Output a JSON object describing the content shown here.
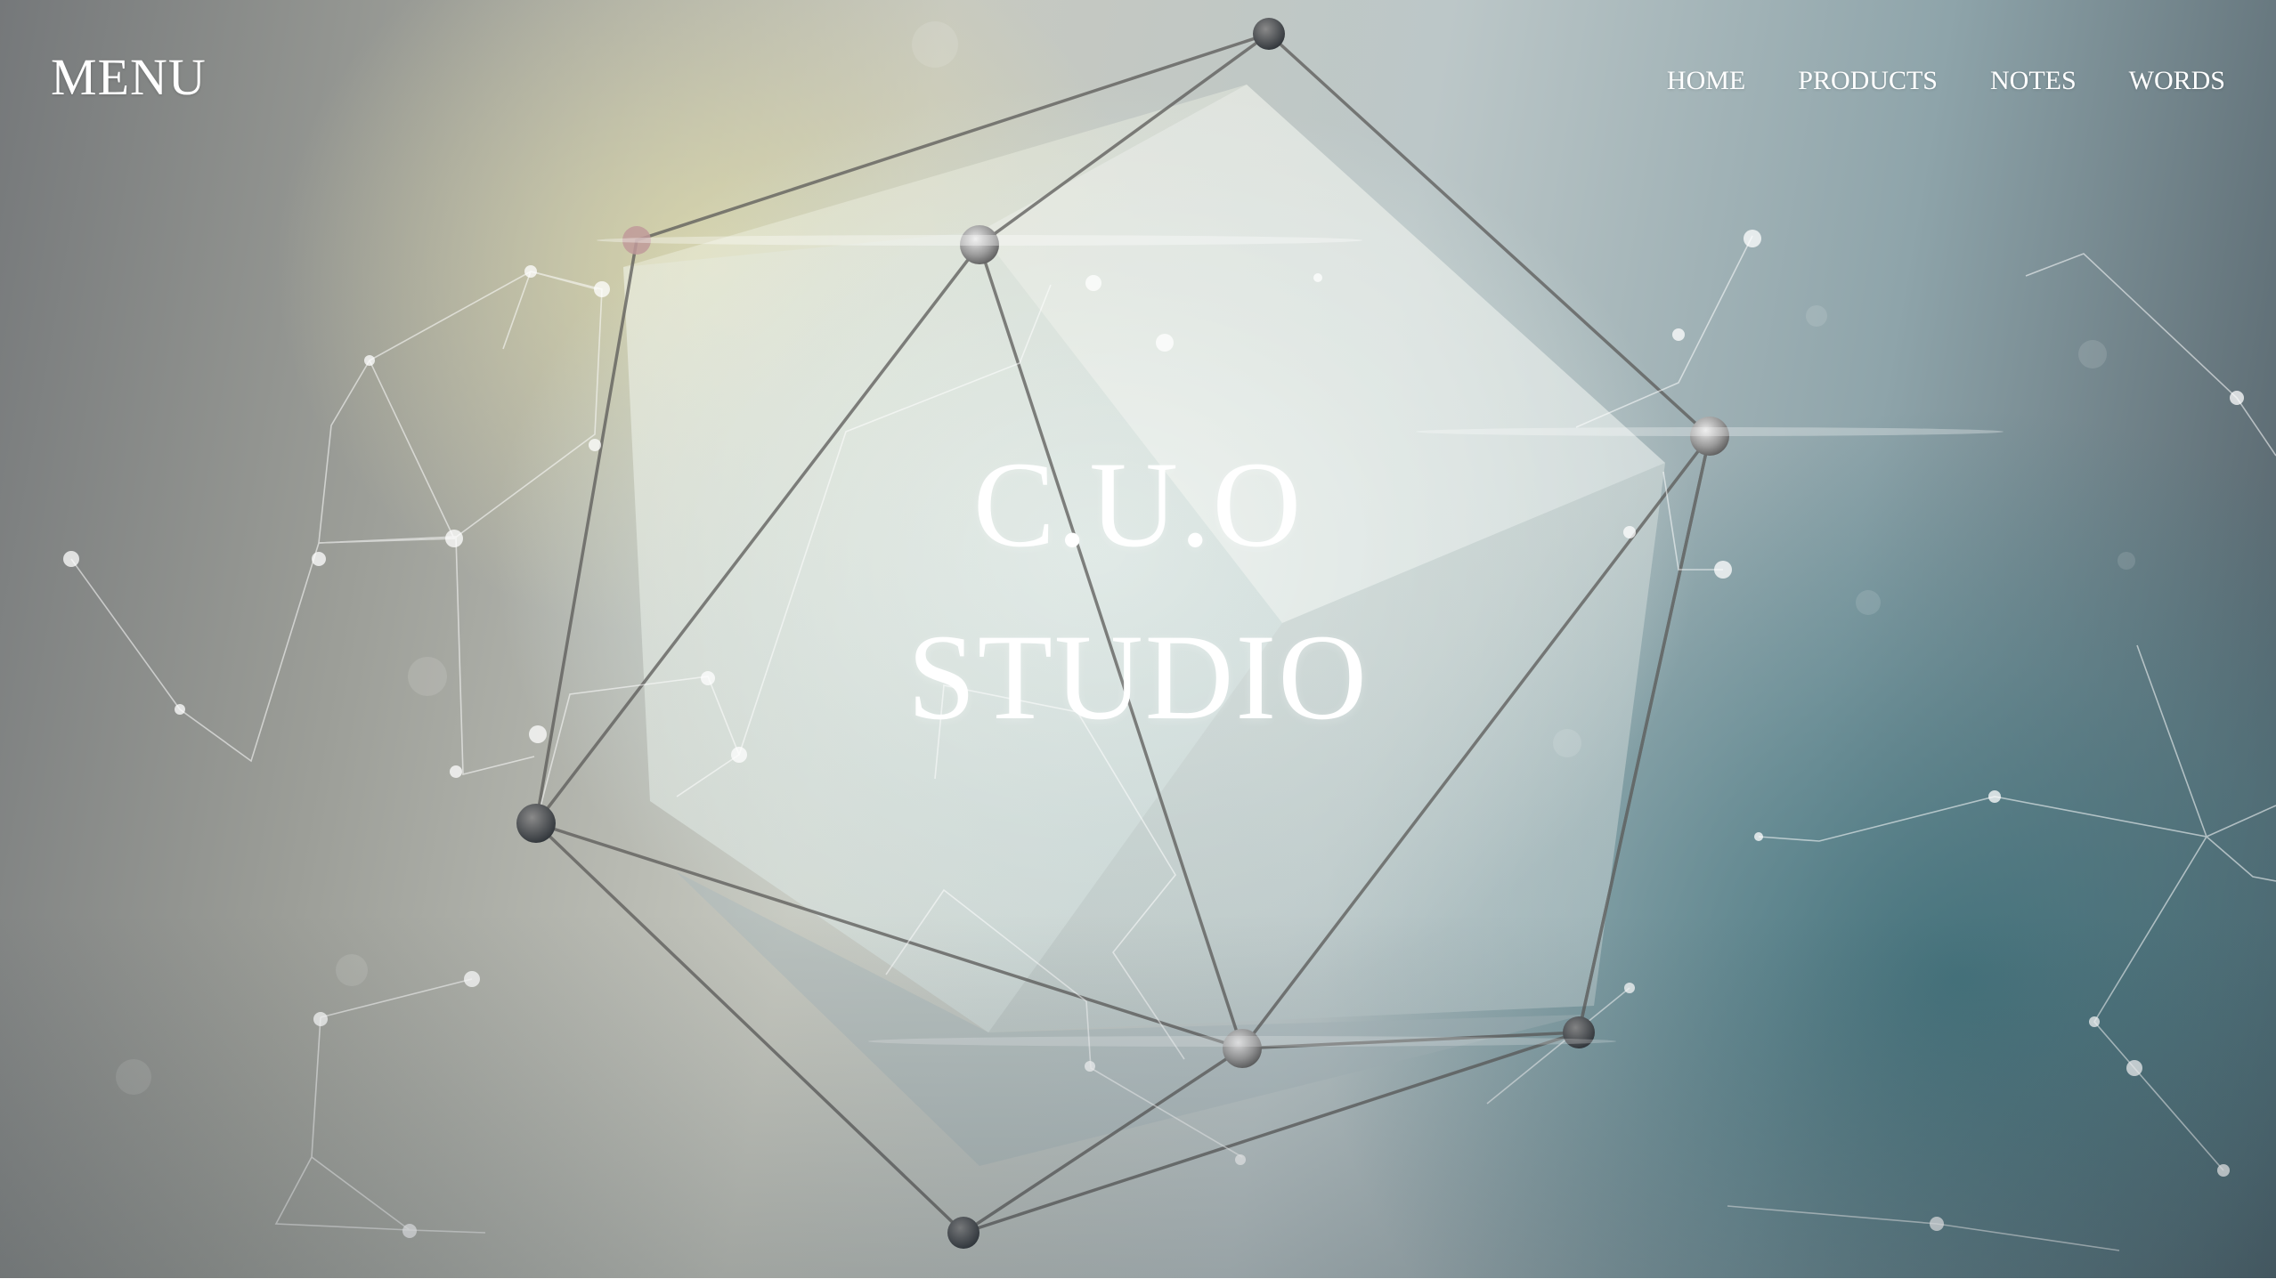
{
  "header": {
    "menu_label": "MENU",
    "nav": [
      {
        "label": "HOME"
      },
      {
        "label": "PRODUCTS"
      },
      {
        "label": "NOTES"
      },
      {
        "label": "WORDS"
      }
    ]
  },
  "hero": {
    "title_line1": "C.U.O",
    "title_line2": "STUDIO"
  },
  "background": {
    "image": "abstract-polyhedron-network",
    "colors": {
      "left": "#75787a",
      "center": "#e6ece8",
      "warm_highlight": "#e2dcaa",
      "right": "#4d5a62",
      "text": "#ffffff"
    }
  }
}
